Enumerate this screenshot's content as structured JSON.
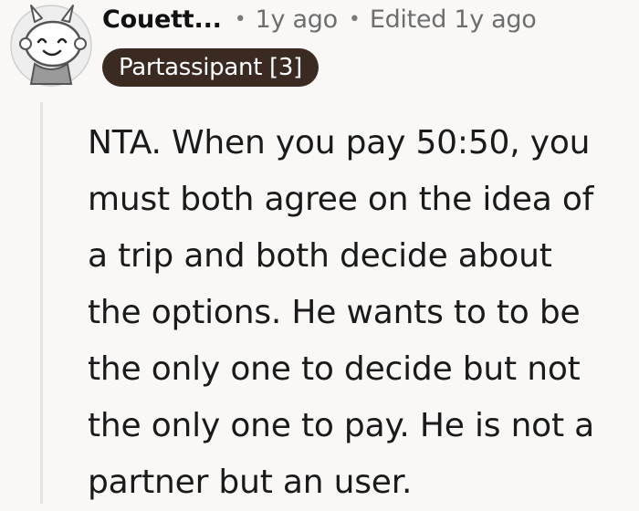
{
  "comment": {
    "author": "Couett...",
    "time_ago": "1y ago",
    "edited": "Edited 1y ago",
    "flair": "Partassipant [3]",
    "avatar_icon": "snoo-avatar-icon",
    "body_lines": [
      "NTA. When you pay 50:50, you",
      "must both agree on the idea of",
      "a trip and both decide about",
      "the options. He wants to to be",
      "the only one to decide but not",
      "the only one to pay. He is not a",
      "partner but an user."
    ]
  },
  "colors": {
    "flair_background": "#3a2a22",
    "meta_text": "#6e6e6e",
    "thread_line": "#e5e3e0"
  }
}
